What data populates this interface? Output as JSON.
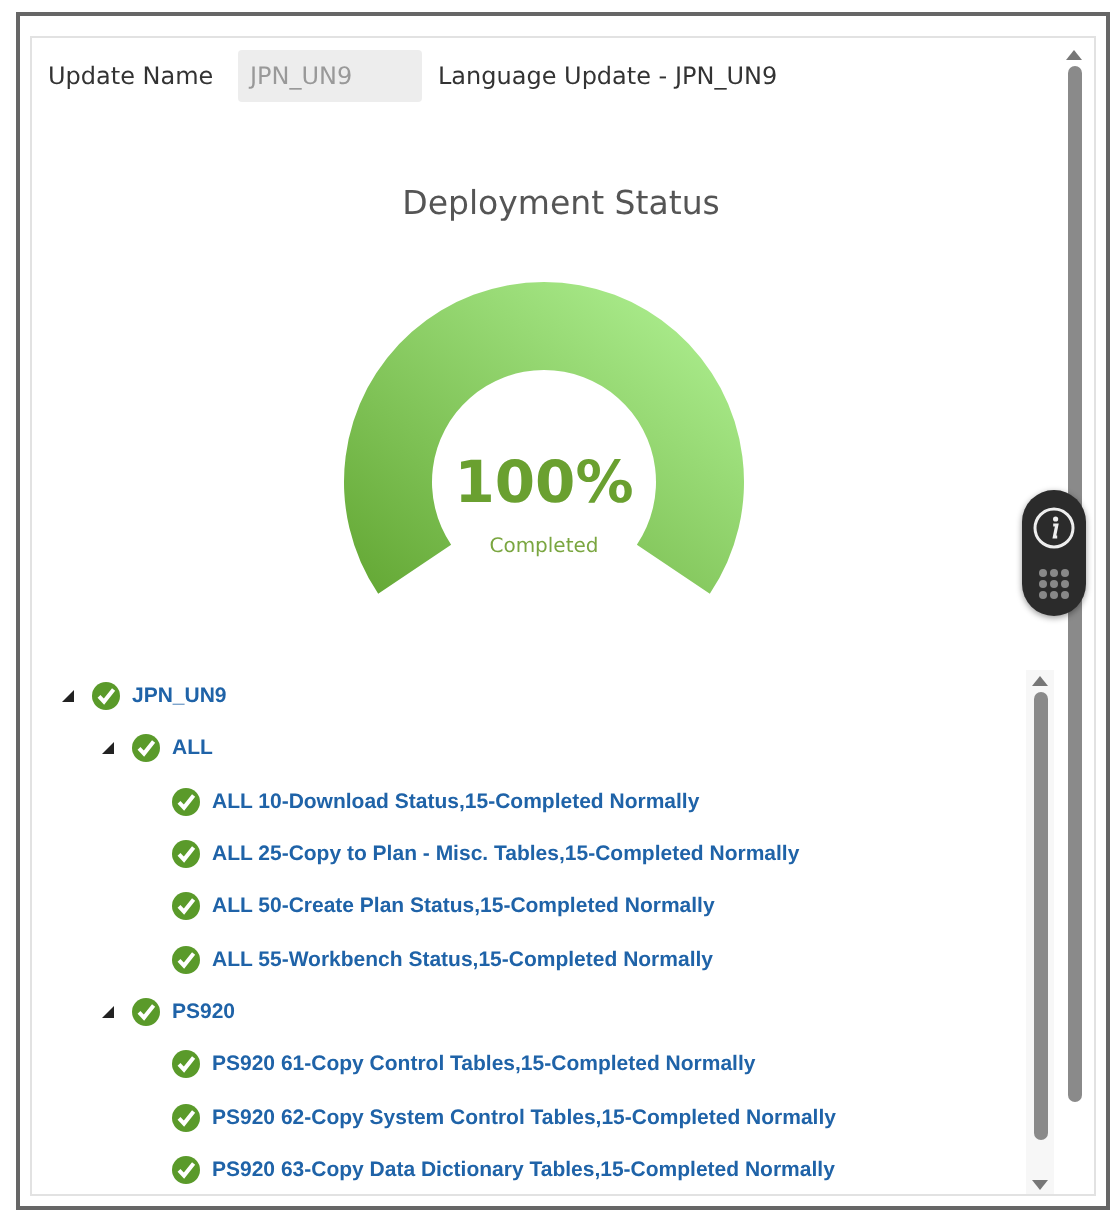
{
  "form": {
    "label": "Update Name",
    "field_value": "JPN_UN9",
    "description": "Language Update - JPN_UN9"
  },
  "chart_title": "Deployment Status",
  "gauge": {
    "value": "100%",
    "caption": "Completed"
  },
  "tree": [
    {
      "label": "JPN_UN9",
      "completed": true,
      "expanded": true,
      "children": [
        {
          "label": "ALL",
          "completed": true,
          "expanded": true,
          "children": [
            {
              "label": "ALL 10-Download Status,15-Completed Normally",
              "completed": true
            },
            {
              "label": "ALL 25-Copy to Plan - Misc. Tables,15-Completed Normally",
              "completed": true
            },
            {
              "label": "ALL 50-Create Plan Status,15-Completed Normally",
              "completed": true
            },
            {
              "label": "ALL 55-Workbench Status,15-Completed Normally",
              "completed": true
            }
          ]
        },
        {
          "label": "PS920",
          "completed": true,
          "expanded": true,
          "children": [
            {
              "label": "PS920 61-Copy Control Tables,15-Completed Normally",
              "completed": true
            },
            {
              "label": "PS920 62-Copy System Control Tables,15-Completed Normally",
              "completed": true
            },
            {
              "label": "PS920 63-Copy Data Dictionary Tables,15-Completed Normally",
              "completed": true
            }
          ]
        }
      ]
    }
  ]
}
